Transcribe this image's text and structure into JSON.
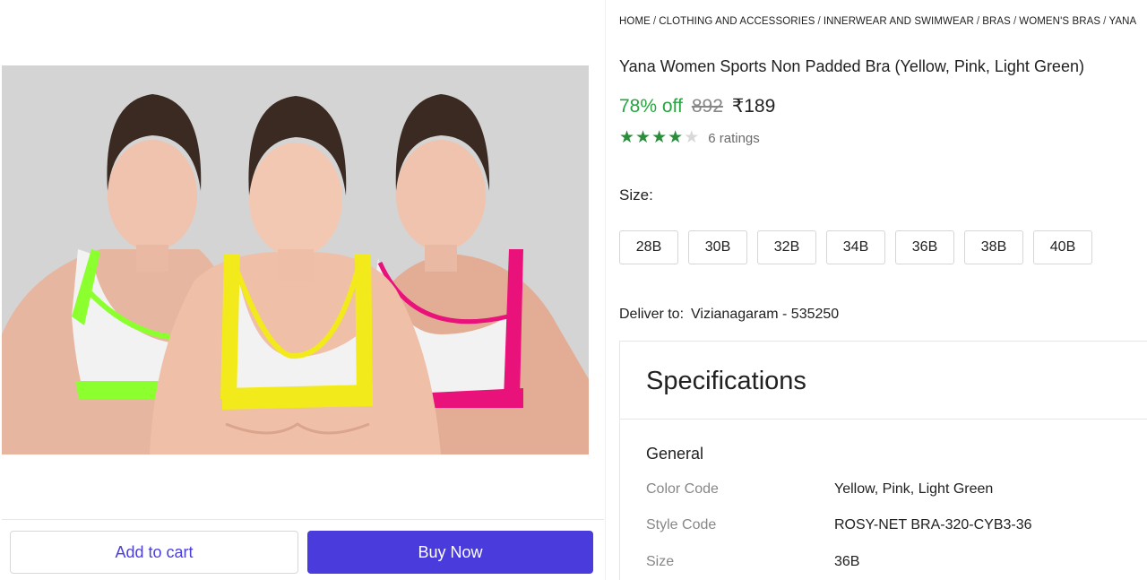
{
  "breadcrumb": [
    "HOME",
    "CLOTHING AND ACCESSORIES",
    "INNERWEAR AND SWIMWEAR",
    "BRAS",
    "WOMEN'S BRAS",
    "YANA"
  ],
  "product": {
    "title": "Yana Women Sports Non Padded Bra (Yellow, Pink, Light Green)",
    "discount": "78% off",
    "mrp": "892",
    "price": "₹189",
    "rating": 4,
    "rating_max": 5,
    "ratings_text": "6 ratings",
    "image_colors": [
      "#8cff2e",
      "#f2ea1a",
      "#e8127a"
    ]
  },
  "size": {
    "label": "Size:",
    "options": [
      "28B",
      "30B",
      "32B",
      "34B",
      "36B",
      "38B",
      "40B"
    ]
  },
  "delivery": {
    "label": "Deliver to:",
    "location": "Vizianagaram - 535250"
  },
  "specifications": {
    "title": "Specifications",
    "section": "General",
    "rows": [
      {
        "key": "Color Code",
        "value": "Yellow, Pink, Light Green"
      },
      {
        "key": "Style Code",
        "value": "ROSY-NET BRA-320-CYB3-36"
      },
      {
        "key": "Size",
        "value": "36B"
      }
    ]
  },
  "actions": {
    "add_to_cart": "Add to cart",
    "buy_now": "Buy Now"
  },
  "colors": {
    "discount_green": "#26a541",
    "star_green": "#2a8d3a",
    "buy_button": "#4a3bdc",
    "cart_text": "#4b3fd9"
  }
}
